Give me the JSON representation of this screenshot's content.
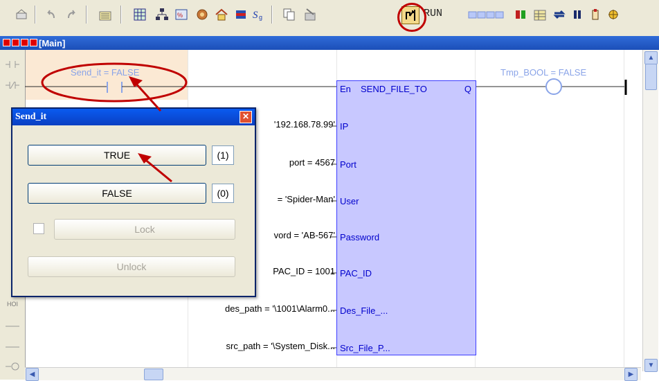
{
  "toolbar": {
    "run_label": "RUN",
    "icons": [
      "new-program-icon",
      "undo-icon",
      "redo-icon",
      "comment-icon",
      "variables-grid-icon",
      "network-icon",
      "function-block-icon",
      "library-icon",
      "home-icon",
      "flag-icon",
      "script-icon",
      "copy-icon",
      "download-icon",
      "online-mode-icon",
      "status-leds-icon",
      "debug-icon",
      "spreadsheet-icon",
      "cycle-icon",
      "pause-icon",
      "step-icon",
      "breakpoint-icon"
    ]
  },
  "window": {
    "title": "[Main]"
  },
  "ladder": {
    "contact_label": "Send_it = FALSE",
    "coil_label": "Tmp_BOOL = FALSE",
    "left_tool_labels": [
      "HOI"
    ],
    "inputs": [
      {
        "value": "'192.168.78.99'",
        "pin": "IP"
      },
      {
        "value": "port = 4567",
        "pin": "Port"
      },
      {
        "value": "= 'Spider-Man'",
        "pin": "User"
      },
      {
        "value": "vord = 'AB-567'",
        "pin": "Password"
      },
      {
        "value": "PAC_ID = 1001",
        "pin": "PAC_ID"
      },
      {
        "value": "des_path = '\\1001\\Alarm0...",
        "pin": "Des_File_..."
      },
      {
        "value": "src_path = '\\System_Disk...",
        "pin": "Src_File_P..."
      }
    ],
    "block": {
      "en": "En",
      "name": "SEND_FILE_TO",
      "q": "Q"
    }
  },
  "dialog": {
    "title": "Send_it",
    "true_label": "TRUE",
    "true_badge": "(1)",
    "false_label": "FALSE",
    "false_badge": "(0)",
    "lock_label": "Lock",
    "unlock_label": "Unlock",
    "close_icon": "close-icon"
  },
  "colors": {
    "highlight_red": "#c00000",
    "block_fill": "#c8c8ff",
    "block_border": "#3c3cff",
    "contact_text": "#8aa4e8",
    "titlebar_blue": "#1c4fb8"
  }
}
